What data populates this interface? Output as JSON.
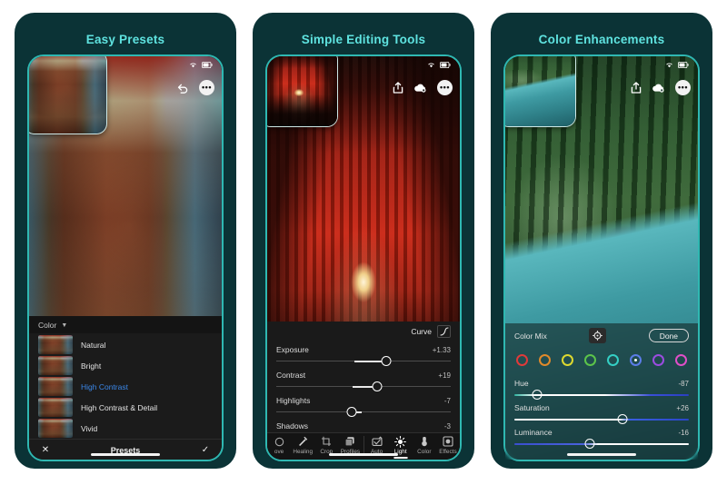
{
  "panels": [
    {
      "title": "Easy Presets",
      "status": {
        "wifi": "wifi-icon",
        "battery": "battery-icon"
      },
      "top_icons": [
        "undo-icon",
        "more-icon"
      ],
      "more_label": "•••",
      "tray": {
        "group_label": "Color",
        "chevron": "▼",
        "presets": [
          {
            "name": "Natural",
            "active": false
          },
          {
            "name": "Bright",
            "active": false
          },
          {
            "name": "High Contrast",
            "active": true
          },
          {
            "name": "High Contrast & Detail",
            "active": false
          },
          {
            "name": "Vivid",
            "active": false
          }
        ],
        "footer": {
          "close": "✕",
          "title": "Presets",
          "confirm": "✓"
        }
      }
    },
    {
      "title": "Simple Editing Tools",
      "top_icons": [
        "share-icon",
        "cloud-icon",
        "more-icon"
      ],
      "more_label": "•••",
      "curve": {
        "label": "Curve",
        "icon": "tone-curve-icon"
      },
      "sliders": [
        {
          "name": "Exposure",
          "value": "+1.33",
          "pos": 63,
          "fill_from": 45
        },
        {
          "name": "Contrast",
          "value": "+19",
          "pos": 58,
          "fill_from": 44
        },
        {
          "name": "Highlights",
          "value": "-7",
          "pos": 43,
          "fill_from": 43
        },
        {
          "name": "Shadows",
          "value": "-3",
          "pos": 46,
          "fill_from": 46
        }
      ],
      "tabs": [
        {
          "label": "ove",
          "icon": "remove-icon",
          "selected": false
        },
        {
          "label": "Healing",
          "icon": "healing-icon",
          "selected": false
        },
        {
          "label": "Crop",
          "icon": "crop-icon",
          "selected": false
        },
        {
          "label": "Profiles",
          "icon": "profiles-icon",
          "selected": false
        },
        {
          "label": "Auto",
          "icon": "auto-icon",
          "selected": false
        },
        {
          "label": "Light",
          "icon": "light-icon",
          "selected": true
        },
        {
          "label": "Color",
          "icon": "color-icon",
          "selected": false
        },
        {
          "label": "Effects",
          "icon": "effects-icon",
          "selected": false
        }
      ]
    },
    {
      "title": "Color Enhancements",
      "top_icons": [
        "share-icon",
        "cloud-icon",
        "more-icon"
      ],
      "more_label": "•••",
      "mix": {
        "label": "Color Mix",
        "target_icon": "target-eyedropper-icon",
        "done_label": "Done",
        "swatches": [
          {
            "name": "red",
            "color": "#e03a3a",
            "selected": false
          },
          {
            "name": "orange",
            "color": "#e08a2a",
            "selected": false
          },
          {
            "name": "yellow",
            "color": "#ddd82f",
            "selected": false
          },
          {
            "name": "green",
            "color": "#5cc44a",
            "selected": false
          },
          {
            "name": "aqua",
            "color": "#34cfc4",
            "selected": false
          },
          {
            "name": "blue",
            "color": "#5b7ce8",
            "selected": true
          },
          {
            "name": "purple",
            "color": "#9b4ce0",
            "selected": false
          },
          {
            "name": "magenta",
            "color": "#e04fc8",
            "selected": false
          }
        ],
        "sliders": [
          {
            "name": "Hue",
            "value": "-87",
            "pos": 13,
            "gradient": "linear-gradient(90deg,#2fb3a0 0%,#ffffff 12%,#ffffff 52%,#3a4fd8 78%,#2a3fc0 100%)"
          },
          {
            "name": "Saturation",
            "value": "+26",
            "pos": 62,
            "gradient": "linear-gradient(90deg,#ffffff 0%,#ffffff 60%,#3a5fe0 66%,#2a46c8 100%)"
          },
          {
            "name": "Luminance",
            "value": "-16",
            "pos": 43,
            "gradient": "linear-gradient(90deg,#3a4fd0 0%,#4a62dd 40%,#ffffff 48%,#ffffff 100%)"
          }
        ]
      }
    }
  ]
}
